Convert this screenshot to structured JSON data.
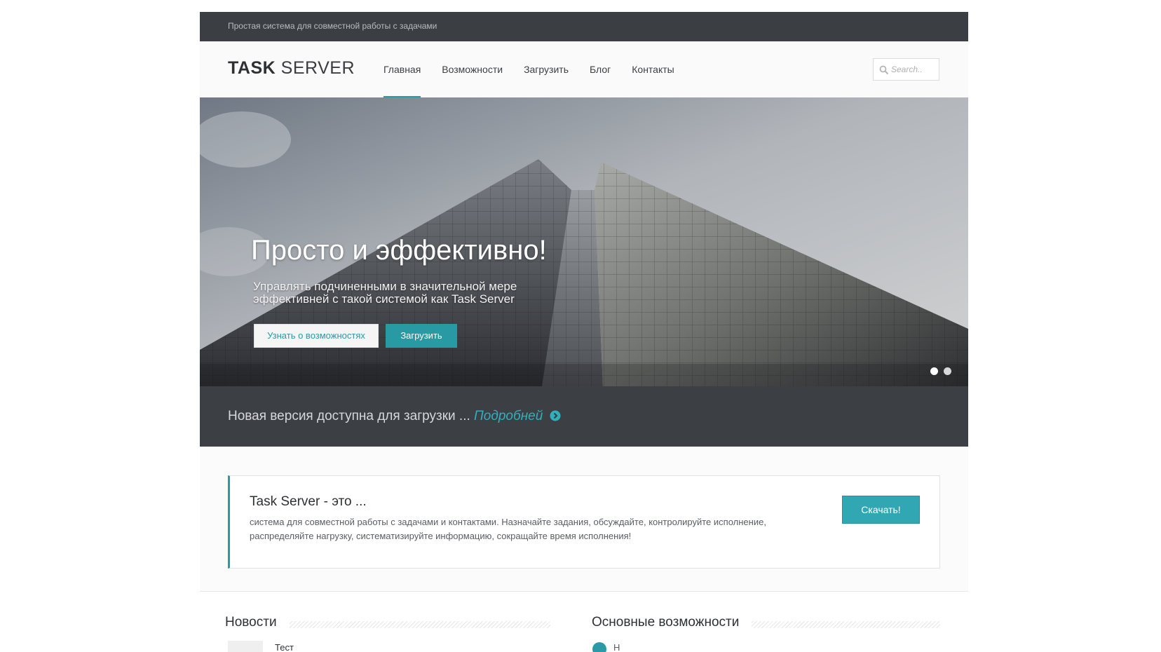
{
  "topbar": {
    "tagline": "Простая система для совместной работы с задачами"
  },
  "header": {
    "logo_bold": "TASK",
    "logo_light": "SERVER",
    "nav": [
      {
        "label": "Главная",
        "active": true
      },
      {
        "label": "Возможности",
        "active": false
      },
      {
        "label": "Загрузить",
        "active": false
      },
      {
        "label": "Блог",
        "active": false
      },
      {
        "label": "Контакты",
        "active": false
      }
    ],
    "search_placeholder": "Search.."
  },
  "hero": {
    "title": "Просто и эффективно!",
    "subtitle": "Управлять подчиненными в значительной мере эффективней с такой системой как Task Server",
    "button_features": "Узнать о возможностях",
    "button_download": "Загрузить",
    "slide_count": 2,
    "active_slide": 1
  },
  "notice": {
    "text": "Новая версия доступна для загрузки ...",
    "link": "Подробней",
    "icon": "chevron-circle-right-icon"
  },
  "callout": {
    "title": "Task Server - это ...",
    "text": "система для совместной работы с задачами и контактами. Назначайте задания, обсуждайте, контролируйте исполнение, распределяйте нагрузку, систематизируйте информацию, сокращайте время исполнения!",
    "button": "Скачать!"
  },
  "sections": {
    "news_title": "Новости",
    "news_first_item": "Тест",
    "features_title": "Основные возможности",
    "features_first_item": "Н"
  },
  "colors": {
    "accent": "#2b9aa6",
    "dark_bar": "#3b3e42",
    "link": "#2fb1bd"
  }
}
